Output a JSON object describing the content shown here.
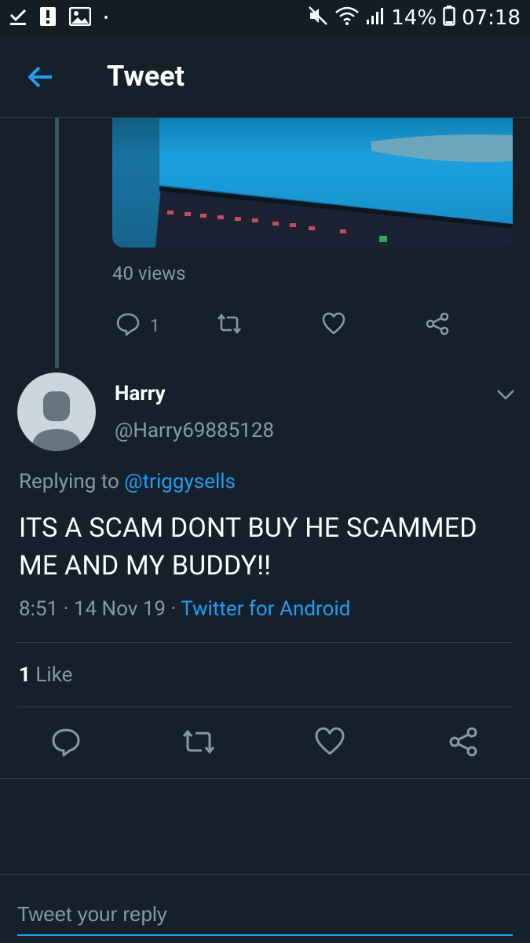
{
  "status_bar": {
    "battery": "14%",
    "time": "07:18",
    "dot": "•",
    "icons": [
      "download-done-icon",
      "alert-icon",
      "image-icon",
      "mute-icon",
      "wifi-icon",
      "signal-icon",
      "battery-icon"
    ]
  },
  "header": {
    "title": "Tweet",
    "back_icon": "arrow-left-icon"
  },
  "parent_tweet": {
    "views": "40 views",
    "reply_count": "1"
  },
  "tweet": {
    "name": "Harry",
    "handle": "@Harry69885128",
    "replying_prefix": "Replying to",
    "replying_handle": "@triggysells",
    "text": "ITS A SCAM DONT BUY HE SCAMMED ME AND MY BUDDY!!",
    "time": "8:51",
    "date": "14 Nov 19",
    "separator": "·",
    "source": "Twitter for Android",
    "like_count": "1",
    "like_label": "Like"
  },
  "reply": {
    "placeholder": "Tweet your reply"
  },
  "colors": {
    "background": "#15202b",
    "accent": "#1da1f2",
    "secondary_text": "#8899a6",
    "divider": "#2f3f4f"
  }
}
